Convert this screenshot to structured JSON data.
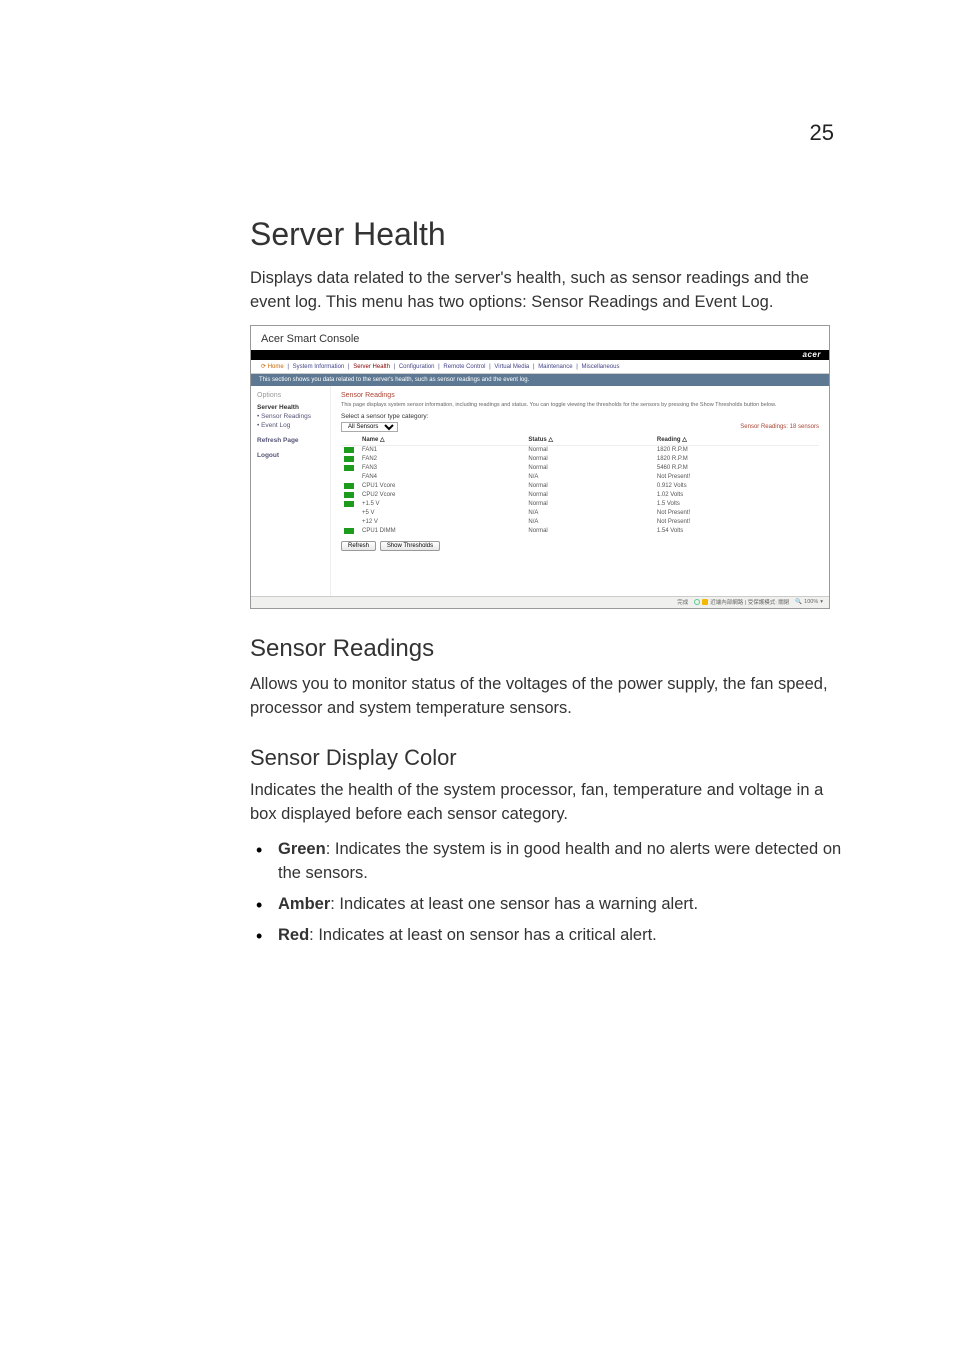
{
  "pagenum": "25",
  "h1": "Server Health",
  "p1": "Displays data related to the server's health, such as sensor readings and the event log. This menu has two options: Sensor Readings and Event Log.",
  "h2a": "Sensor Readings",
  "p2": "Allows you to monitor status of the voltages of the power supply, the fan speed, processor and system temperature sensors.",
  "h3a": "Sensor Display Color",
  "p3": "Indicates the health of the system processor, fan, temperature and voltage in a box displayed before each sensor category.",
  "bullets": {
    "b1_label": "Green",
    "b1_text": ": Indicates the system is in good health and no alerts were detected on the sensors.",
    "b2_label": "Amber",
    "b2_text": ": Indicates at least one sensor has a warning alert.",
    "b3_label": "Red",
    "b3_text": ": Indicates at least on sensor has a critical alert."
  },
  "shot": {
    "title": "Acer Smart Console",
    "logo": "acer",
    "tabs": {
      "home": "Home",
      "sysinfo": "System Information",
      "health": "Server Health",
      "config": "Configuration",
      "remote": "Remote Control",
      "vmedia": "Virtual Media",
      "maint": "Maintenance",
      "misc": "Miscellaneous"
    },
    "bluebar": "This section shows you data related to the server's health, such as sensor readings and the event log.",
    "side": {
      "hd": "Options",
      "item1": "Server Health",
      "item2": "Sensor Readings",
      "item3": "Event Log",
      "refresh": "Refresh Page",
      "logout": "Logout"
    },
    "content": {
      "hd": "Sensor Readings",
      "helper": "This page displays system sensor information, including readings and status. You can toggle viewing the thresholds for the sensors by pressing the Show Thresholds button below.",
      "selLabel": "Select a sensor type category:",
      "selValue": "All Sensors",
      "count": "Sensor Readings: 18 sensors",
      "cols": {
        "name": "Name",
        "status": "Status",
        "reading": "Reading"
      },
      "rows": [
        {
          "color": "green",
          "name": "FAN1",
          "status": "Normal",
          "reading": "1820 R.P.M"
        },
        {
          "color": "green",
          "name": "FAN2",
          "status": "Normal",
          "reading": "1820 R.P.M"
        },
        {
          "color": "green",
          "name": "FAN3",
          "status": "Normal",
          "reading": "5460 R.P.M"
        },
        {
          "color": "",
          "name": "FAN4",
          "status": "N/A",
          "reading": "Not Present!"
        },
        {
          "color": "green",
          "name": "CPU1 Vcore",
          "status": "Normal",
          "reading": "0.912 Volts"
        },
        {
          "color": "green",
          "name": "CPU2 Vcore",
          "status": "Normal",
          "reading": "1.02 Volts"
        },
        {
          "color": "green",
          "name": "+1.5 V",
          "status": "Normal",
          "reading": "1.5 Volts"
        },
        {
          "color": "",
          "name": "+5 V",
          "status": "N/A",
          "reading": "Not Present!"
        },
        {
          "color": "",
          "name": "+12 V",
          "status": "N/A",
          "reading": "Not Present!"
        },
        {
          "color": "green",
          "name": "CPU1 DIMM",
          "status": "Normal",
          "reading": "1.54 Volts"
        }
      ],
      "btnRefresh": "Refresh",
      "btnShow": "Show Thresholds"
    },
    "status": {
      "doneIcon": "✔",
      "zoneText": "近端內部網路 | 受保護模式: 關閉",
      "zoom": "100%"
    }
  }
}
